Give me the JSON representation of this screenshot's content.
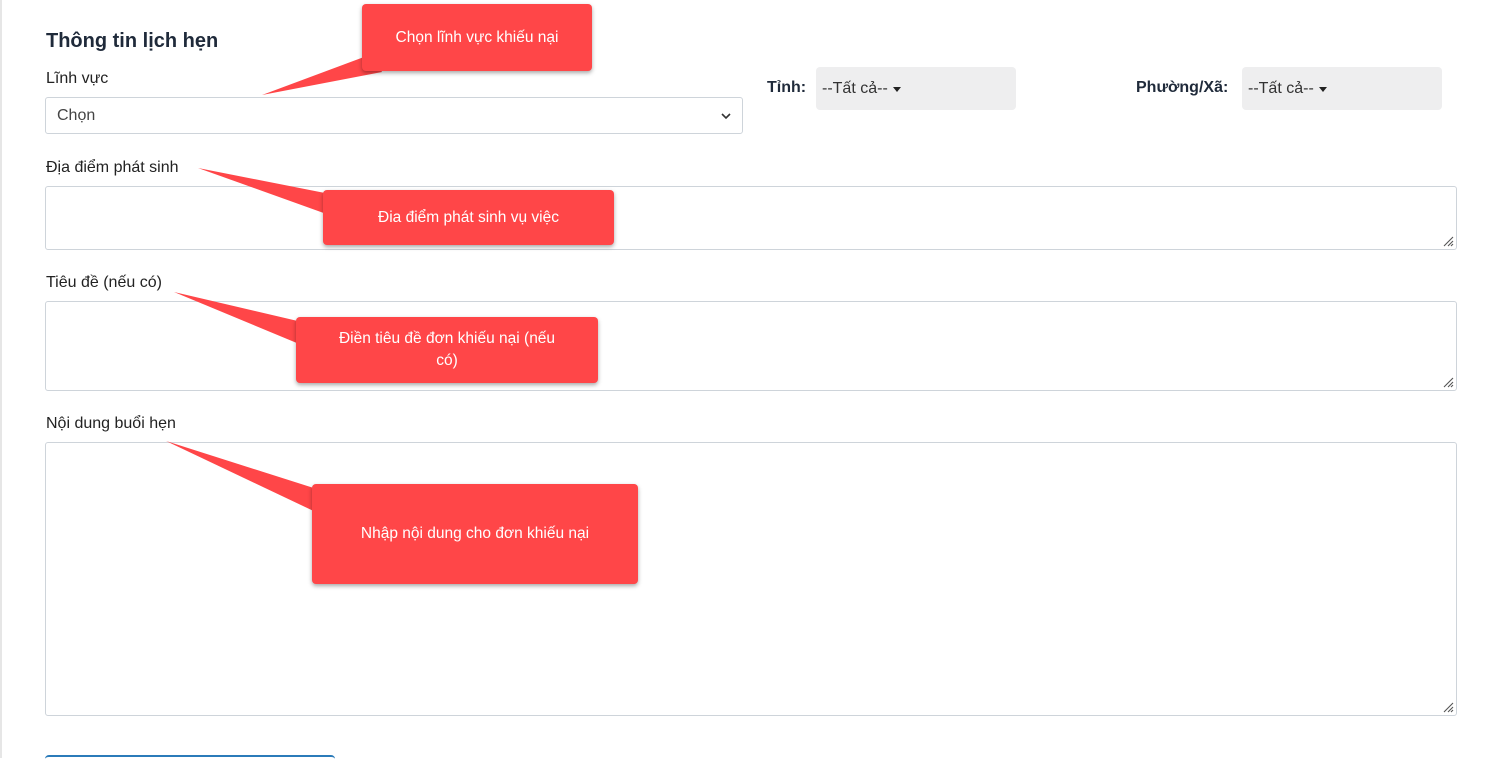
{
  "form": {
    "section_title": "Thông tin lịch hẹn",
    "field_label": "Lĩnh vực",
    "field_select_value": "Chọn",
    "province_label": "Tỉnh:",
    "province_value": "--Tất cả--",
    "ward_label": "Phường/Xã:",
    "ward_value": "--Tất cả--",
    "location_label": "Địa điểm phát sinh",
    "title_label": "Tiêu đề (nếu có)",
    "content_label": "Nội dung buổi hẹn"
  },
  "callouts": {
    "field": "Chọn lĩnh vực khiếu nại",
    "location": "Đia điểm phát sinh vụ việc",
    "title": "Điền tiêu đề đơn khiếu nại (nếu có)",
    "content": "Nhập nội dung cho đơn khiếu nại"
  },
  "colors": {
    "callout_bg": "#ff4648",
    "dropdown_bg": "#eeeeef",
    "button_accent": "#2b7bb9"
  }
}
